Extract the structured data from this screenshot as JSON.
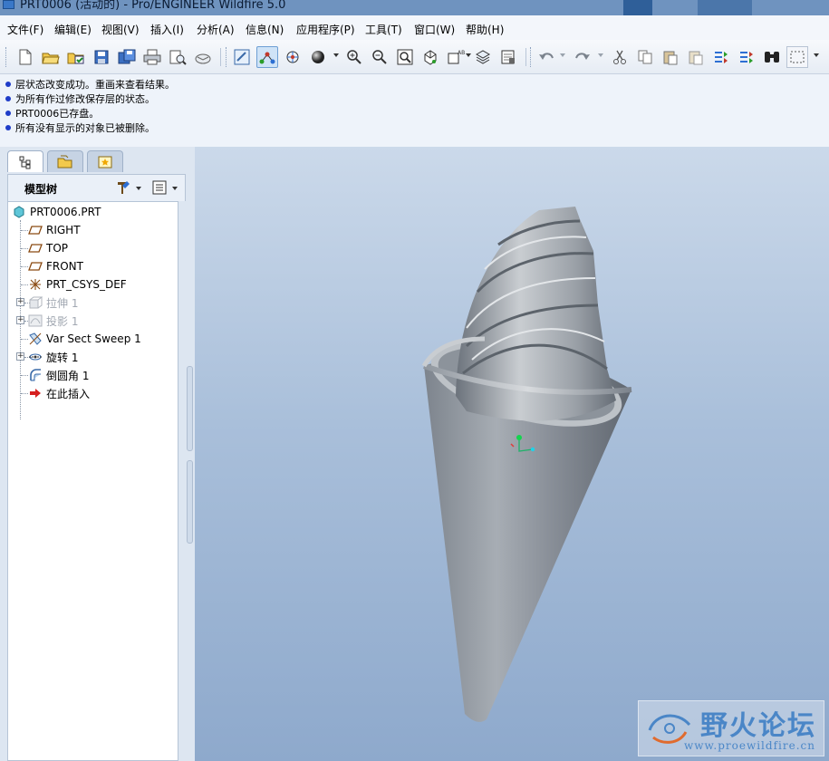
{
  "window": {
    "title": "PRT0006 (活动的) - Pro/ENGINEER Wildfire 5.0"
  },
  "menu": {
    "items": [
      "文件(F)",
      "编辑(E)",
      "视图(V)",
      "插入(I)",
      "分析(A)",
      "信息(N)",
      "应用程序(P)",
      "工具(T)",
      "窗口(W)",
      "帮助(H)"
    ]
  },
  "toolbar": {
    "buttons": [
      "new-icon",
      "open-icon",
      "open-session-icon",
      "save-icon",
      "save-copy-icon",
      "print-icon",
      "print-preview-icon",
      "send-mail-icon",
      "redraw-icon",
      "spin-center-icon",
      "orient-mode-icon",
      "shade-icon",
      "zoom-in-icon",
      "zoom-out-icon",
      "refit-icon",
      "reorient-icon",
      "saved-views-icon",
      "layers-icon",
      "view-manager-icon",
      "undo-icon",
      "redo-icon",
      "cut-icon",
      "copy-icon",
      "paste-icon",
      "paste-special-icon",
      "regenerate-icon",
      "regen-manager-icon",
      "find-icon",
      "select-box-icon"
    ]
  },
  "messages": [
    "层状态改变成功。重画来查看结果。",
    "为所有作过修改保存层的状态。",
    "PRT0006已存盘。",
    "所有没有显示的对象已被删除。"
  ],
  "model_tree": {
    "title": "模型树",
    "items": [
      {
        "label": "PRT0006.PRT",
        "icon": "part-icon",
        "dim": false
      },
      {
        "label": "RIGHT",
        "icon": "datum-plane-icon",
        "dim": false
      },
      {
        "label": "TOP",
        "icon": "datum-plane-icon",
        "dim": false
      },
      {
        "label": "FRONT",
        "icon": "datum-plane-icon",
        "dim": false
      },
      {
        "label": "PRT_CSYS_DEF",
        "icon": "csys-icon",
        "dim": false
      },
      {
        "label": "拉伸 1",
        "icon": "extrude-icon",
        "dim": true
      },
      {
        "label": "投影 1",
        "icon": "projection-icon",
        "dim": true
      },
      {
        "label": "Var Sect Sweep 1",
        "icon": "sweep-icon",
        "dim": false
      },
      {
        "label": "旋转 1",
        "icon": "revolve-icon",
        "dim": false
      },
      {
        "label": "倒圆角 1",
        "icon": "round-icon",
        "dim": false
      },
      {
        "label": "在此插入",
        "icon": "insert-here-icon",
        "dim": false
      }
    ]
  },
  "watermark": {
    "title": "野火论坛",
    "url": "www.proewildfire.cn"
  },
  "colors": {
    "accent": "#4a86c7",
    "viewport_top": "#cbd9ea",
    "viewport_bottom": "#8ea9cc",
    "model_gray": "#8c939b"
  }
}
